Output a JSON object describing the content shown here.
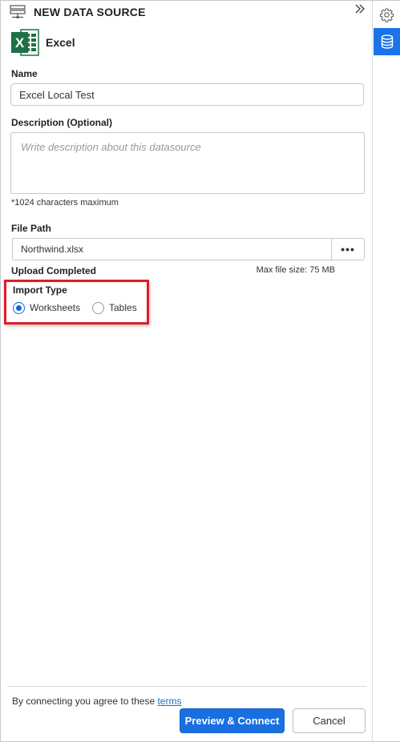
{
  "header": {
    "title": "NEW DATA SOURCE",
    "collapse_icon": "double-chevron-right-icon",
    "datasource_icon": "data-source-icon"
  },
  "connector": {
    "name": "Excel",
    "icon": "excel-icon",
    "icon_letter": "X",
    "accent": "#1e7145"
  },
  "form": {
    "name_label": "Name",
    "name_value": "Excel Local Test",
    "description_label": "Description (Optional)",
    "description_placeholder": "Write description about this datasource",
    "description_value": "",
    "description_hint": "*1024 characters maximum",
    "filepath_label": "File Path",
    "filepath_value": "Northwind.xlsx",
    "browse_label": "•••",
    "upload_status": "Upload Completed",
    "max_file_size": "Max file size: 75 MB",
    "import_type_label": "Import Type",
    "import_options": [
      {
        "label": "Worksheets",
        "selected": true
      },
      {
        "label": "Tables",
        "selected": false
      }
    ]
  },
  "footer": {
    "terms_text": "By connecting you agree to these",
    "terms_link": "terms",
    "primary_button": "Preview & Connect",
    "secondary_button": "Cancel"
  },
  "rail": {
    "settings_icon": "gear-icon",
    "datasource_icon": "database-icon",
    "active": "datasource"
  },
  "colors": {
    "primary": "#1a6fe0",
    "highlight_box": "#e01b24",
    "radio_selected": "#1565d8",
    "rail_active": "#1a73e8"
  }
}
